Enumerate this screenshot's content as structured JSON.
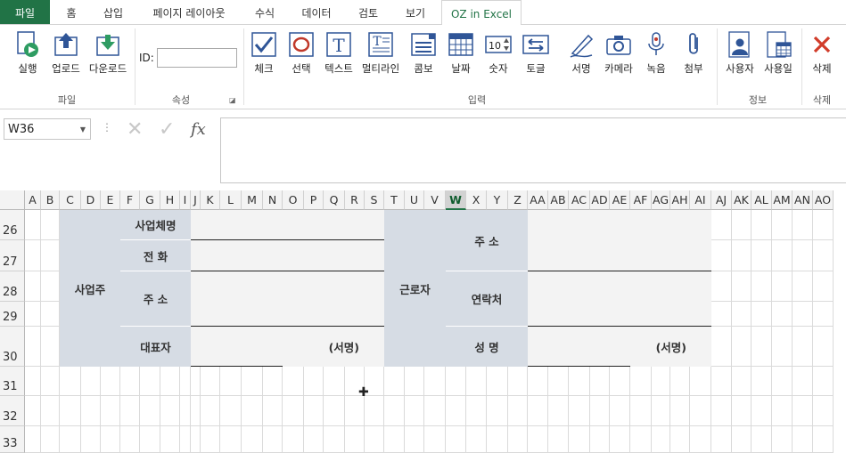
{
  "tabs": [
    "파일",
    "홈",
    "삽입",
    "페이지 레이아웃",
    "수식",
    "데이터",
    "검토",
    "보기",
    "OZ in Excel"
  ],
  "ribbon": {
    "file_group": {
      "label": "파일",
      "buttons": [
        "실행",
        "업로드",
        "다운로드"
      ]
    },
    "attr_group": {
      "label": "속성",
      "id_label": "ID:",
      "id_value": ""
    },
    "input_group": {
      "label": "입력",
      "buttons": [
        "체크",
        "선택",
        "텍스트",
        "멀티라인",
        "콤보",
        "날짜",
        "숫자",
        "토글",
        "서명",
        "카메라",
        "녹음",
        "첨부"
      ]
    },
    "info_group": {
      "label": "정보",
      "buttons": [
        "사용자",
        "사용일"
      ]
    },
    "delete_group": {
      "label": "삭제",
      "buttons": [
        "삭제"
      ]
    }
  },
  "formula_bar": {
    "name_box": "W36",
    "fx_label": "fx",
    "formula": ""
  },
  "columns": [
    "A",
    "B",
    "C",
    "D",
    "E",
    "F",
    "G",
    "H",
    "I",
    "J",
    "K",
    "L",
    "M",
    "N",
    "O",
    "P",
    "Q",
    "R",
    "S",
    "T",
    "U",
    "V",
    "W",
    "X",
    "Y",
    "Z",
    "AA",
    "AB",
    "AC",
    "AD",
    "AE",
    "AF",
    "AG",
    "AH",
    "AI",
    "AJ",
    "AK",
    "AL",
    "AM",
    "AN",
    "AO"
  ],
  "selected_column": "W",
  "rows": [
    "26",
    "27",
    "28",
    "29",
    "30",
    "31",
    "32",
    "33"
  ],
  "form": {
    "employer": "사업주",
    "company_name": "사업체명",
    "phone": "전 화",
    "address_left": "주 소",
    "representative": "대표자",
    "sign_left": "(서명)",
    "worker": "근로자",
    "address_right": "주 소",
    "contact": "연락처",
    "name": "성 명",
    "sign_right": "(서명)"
  },
  "colors": {
    "excel_green": "#217346",
    "label_bg": "#d6dce4",
    "value_bg": "#f3f3f3"
  }
}
